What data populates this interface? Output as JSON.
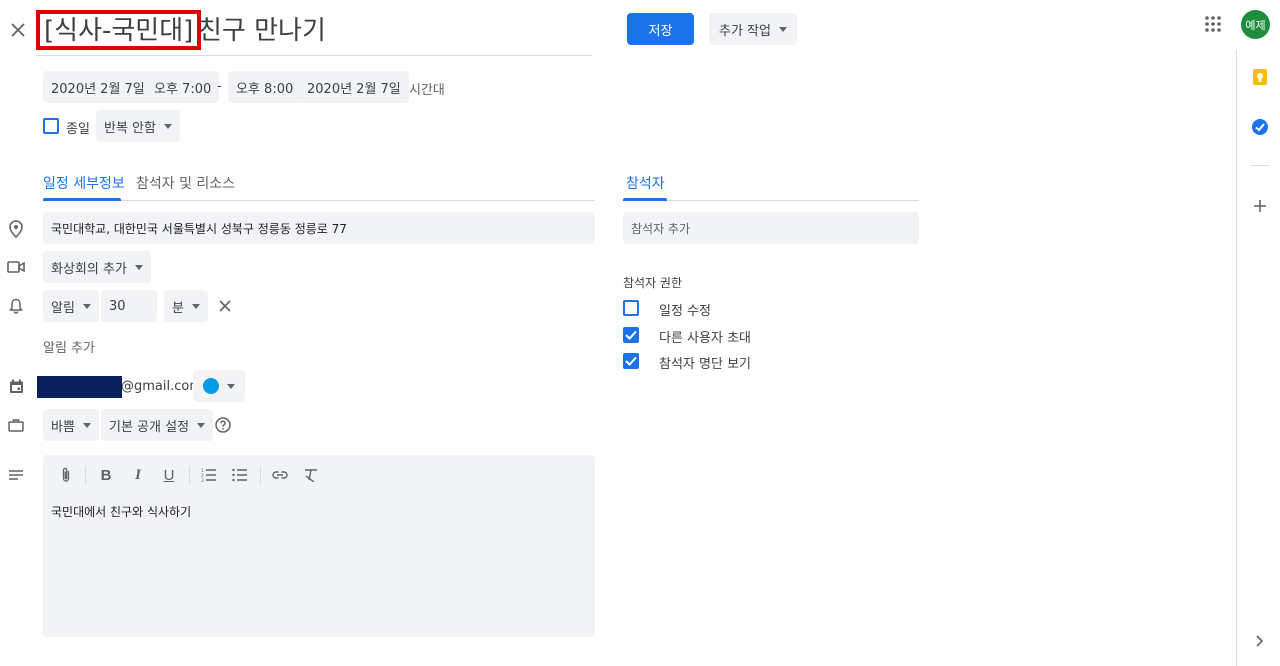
{
  "header": {
    "title_highlight": "[식사-국민대]",
    "title_rest": "친구 만나기",
    "save_label": "저장",
    "more_actions_label": "추가 작업",
    "avatar_text": "예제"
  },
  "datetime": {
    "start_date": "2020년 2월 7일",
    "start_time": "오후 7:00",
    "separator": "-",
    "end_time": "오후 8:00",
    "end_date": "2020년 2월 7일",
    "timezone_label": "시간대",
    "all_day_label": "종일",
    "repeat_label": "반복 안함"
  },
  "tabs": {
    "details": "일정 세부정보",
    "guests_resources": "참석자 및 리소스",
    "guests": "참석자"
  },
  "details": {
    "location": "국민대학교, 대한민국 서울특별시 성북구 정릉동 정릉로 77",
    "video_label": "화상회의 추가",
    "notification_type": "알림",
    "notification_value": "30",
    "notification_unit": "분",
    "add_notification": "알림 추가",
    "calendar_email_suffix": "@gmail.com",
    "calendar_color": "#039be5",
    "busy_label": "바쁨",
    "visibility_label": "기본 공개 설정",
    "description": "국민대에서 친구와 식사하기"
  },
  "guests_panel": {
    "add_guest_placeholder": "참석자 추가",
    "permissions_title": "참석자 권한",
    "permissions": [
      {
        "label": "일정 수정",
        "checked": false
      },
      {
        "label": "다른 사용자 초대",
        "checked": true
      },
      {
        "label": "참석자 명단 보기",
        "checked": true
      }
    ]
  },
  "colors": {
    "accent": "#1a73e8",
    "highlight_border": "#e00000",
    "redaction": "#0a1f5c",
    "avatar_bg": "#1e8e3e",
    "keep_yellow": "#fbbc04",
    "tasks_blue": "#1a73e8"
  },
  "icons": {
    "close": "close-icon",
    "apps": "apps-grid-icon",
    "location": "location-pin-icon",
    "video": "videocam-icon",
    "bell": "bell-icon",
    "calendar": "calendar-icon",
    "briefcase": "briefcase-icon",
    "notes": "notes-icon",
    "help": "help-icon"
  }
}
